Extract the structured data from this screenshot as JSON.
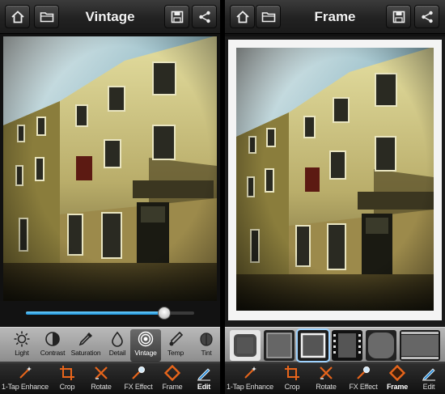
{
  "left_screen": {
    "title": "Vintage",
    "slider_value": 0.82,
    "adjust_tools": [
      {
        "label": "Light",
        "icon": "sun-icon"
      },
      {
        "label": "Contrast",
        "icon": "contrast-icon"
      },
      {
        "label": "Saturation",
        "icon": "dropper-icon"
      },
      {
        "label": "Detail",
        "icon": "drop-icon"
      },
      {
        "label": "Vintage",
        "icon": "vintage-icon",
        "active": true
      },
      {
        "label": "Temp",
        "icon": "thermometer-icon"
      },
      {
        "label": "Tint",
        "icon": "tint-icon"
      }
    ]
  },
  "right_screen": {
    "title": "Frame",
    "frames": [
      "frame-thumb-1",
      "frame-thumb-2",
      "frame-thumb-3",
      "frame-thumb-4",
      "frame-thumb-5",
      "frame-thumb-6"
    ],
    "active_frame_index": 2
  },
  "bottom_tools": [
    {
      "label": "1-Tap Enhance",
      "icon": "magic-wand-icon"
    },
    {
      "label": "Crop",
      "icon": "crop-icon"
    },
    {
      "label": "Rotate",
      "icon": "rotate-icon"
    },
    {
      "label": "FX Effect",
      "icon": "fx-effect-icon"
    },
    {
      "label": "Frame",
      "icon": "frame-icon"
    },
    {
      "label": "Edit",
      "icon": "edit-icon",
      "active": true
    }
  ],
  "colors": {
    "accent_blue": "#1a8fd6",
    "accent_orange": "#e8651b"
  }
}
